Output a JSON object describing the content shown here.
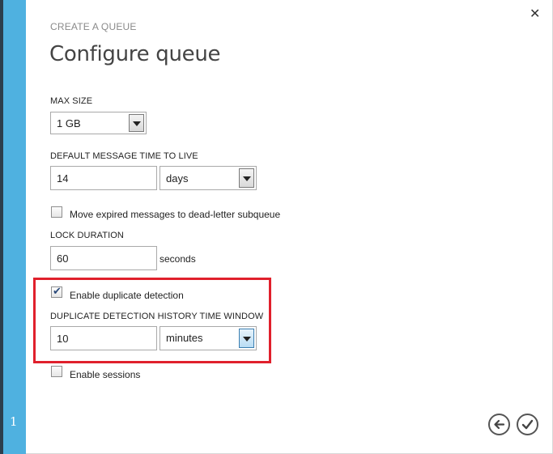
{
  "step": {
    "number": "1"
  },
  "header": {
    "subtitle": "CREATE A QUEUE",
    "title": "Configure queue"
  },
  "max_size": {
    "label": "MAX SIZE",
    "value": "1 GB"
  },
  "ttl": {
    "label": "DEFAULT MESSAGE TIME TO LIVE",
    "value": "14",
    "unit": "days"
  },
  "dead_letter": {
    "label": "Move expired messages to dead-letter subqueue",
    "checked": false
  },
  "lock": {
    "label": "LOCK DURATION",
    "value": "60",
    "unit": "seconds"
  },
  "duplicate": {
    "checkbox_label": "Enable duplicate detection",
    "checked": true,
    "window_label": "DUPLICATE DETECTION HISTORY TIME WINDOW",
    "value": "10",
    "unit": "minutes"
  },
  "sessions": {
    "label": "Enable sessions",
    "checked": false
  },
  "icons": {
    "close": "close-icon",
    "back": "back-arrow-icon",
    "confirm": "checkmark-icon"
  },
  "colors": {
    "rail": "#4fb1e0",
    "highlight": "#e0202c"
  }
}
